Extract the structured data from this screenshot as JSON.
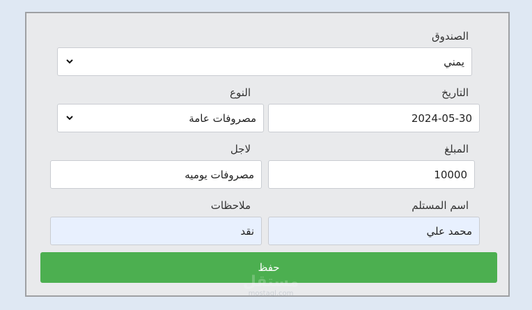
{
  "form": {
    "box": {
      "label": "الصندوق",
      "value": "يمني"
    },
    "date": {
      "label": "التاريخ",
      "value": "2024-05-30"
    },
    "type": {
      "label": "النوع",
      "value": "مصروفات عامة"
    },
    "amount": {
      "label": "المبلغ",
      "value": "10000"
    },
    "purpose": {
      "label": "لاجل",
      "value": "مصروفات يوميه"
    },
    "recipient": {
      "label": "اسم المستلم",
      "value": "محمد علي"
    },
    "notes": {
      "label": "ملاحظات",
      "value": "نقد"
    },
    "save_label": "حفظ"
  },
  "watermark": {
    "text": "مستقل",
    "domain": "mostaql.com"
  },
  "colors": {
    "page_bg": "#dfe8f3",
    "panel_bg": "#e9eaec",
    "save_button": "#4caf50",
    "autofill_bg": "#e8f0fe"
  },
  "icons": {
    "select_arrow": "chevron-down-icon"
  }
}
